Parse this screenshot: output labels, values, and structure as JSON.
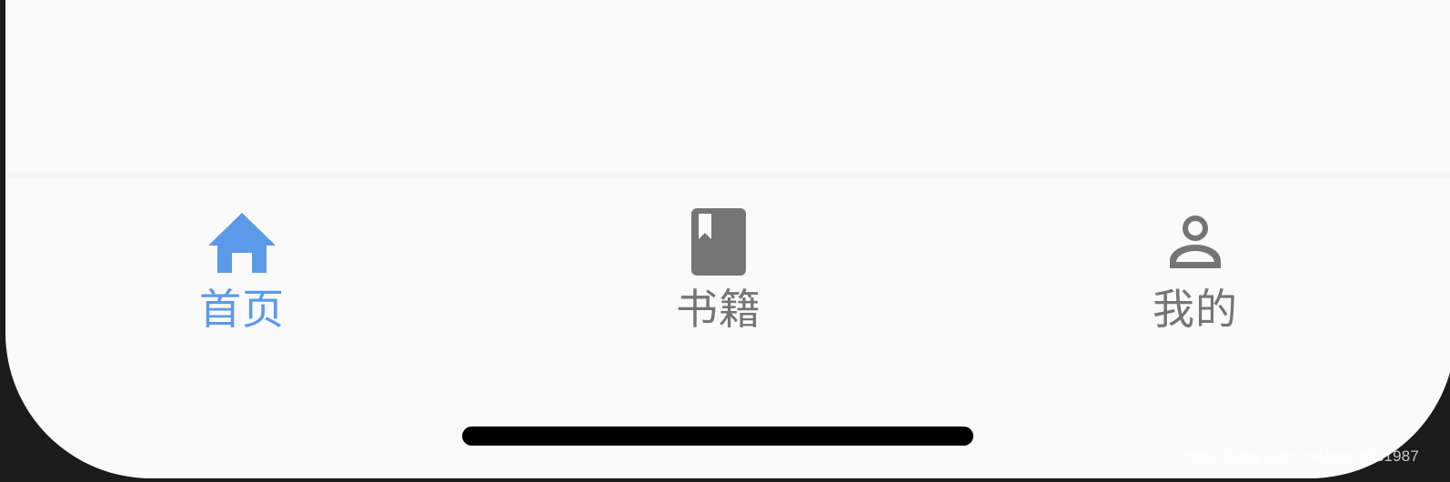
{
  "tabbar": {
    "active_color": "#5b9ae8",
    "inactive_color": "#757575",
    "tabs": [
      {
        "label": "首页",
        "icon": "home-icon",
        "active": true
      },
      {
        "label": "书籍",
        "icon": "book-icon",
        "active": false
      },
      {
        "label": "我的",
        "icon": "person-icon",
        "active": false
      }
    ]
  },
  "watermark": {
    "text": "https://blog.csdn.net/mengks1987"
  }
}
